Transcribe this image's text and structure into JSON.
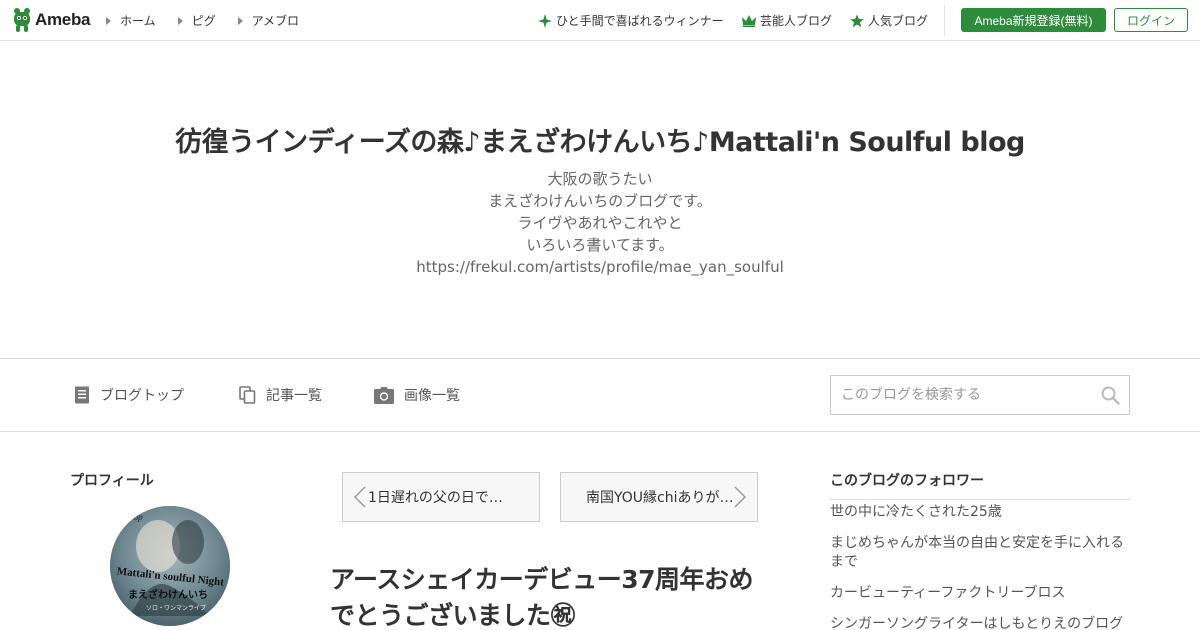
{
  "topbar": {
    "logo_text": "Ameba",
    "nav": [
      "ホーム",
      "ピグ",
      "アメブロ"
    ],
    "right_links": [
      {
        "label": "ひと手間で喜ばれるウィンナー",
        "icon": "sparkle-icon"
      },
      {
        "label": "芸能人ブログ",
        "icon": "crown-icon"
      },
      {
        "label": "人気ブログ",
        "icon": "star-icon"
      }
    ],
    "register_label": "Ameba新規登録(無料)",
    "login_label": "ログイン",
    "accent": "#2d8c3c"
  },
  "header": {
    "title": "彷徨うインディーズの森♪まえざわけんいち♪Mattali'n Soulful blog",
    "description": [
      "大阪の歌うたい",
      "まえざわけんいちのブログです。",
      "ライヴやあれやこれやと",
      "いろいろ書いてます。",
      "https://frekul.com/artists/profile/mae_yan_soulful"
    ]
  },
  "blognav": {
    "items": [
      {
        "label": "ブログトップ",
        "icon": "document-icon"
      },
      {
        "label": "記事一覧",
        "icon": "copy-icon"
      },
      {
        "label": "画像一覧",
        "icon": "camera-icon"
      }
    ],
    "search_placeholder": "このブログを検索する"
  },
  "profile": {
    "heading": "プロフィール",
    "avatar_text": [
      "Mattali'n soulful Night",
      "まえざわけんいち",
      "Drop",
      "ソロ・ワンマンライブ"
    ]
  },
  "pager": {
    "prev": "1日遅れの父の日で…",
    "next": "南国YOU縁chiありが…"
  },
  "entry": {
    "title": "アースシェイカーデビュー37周年おめでとうございました㊗"
  },
  "followers": {
    "heading": "このブログのフォロワー",
    "items": [
      "世の中に冷たくされた25歳",
      "まじめちゃんが本当の自由と安定を手に入れるまで",
      "カービューティーファクトリーブロス",
      "シンガーソングライターはしもとりえのブログ"
    ]
  }
}
